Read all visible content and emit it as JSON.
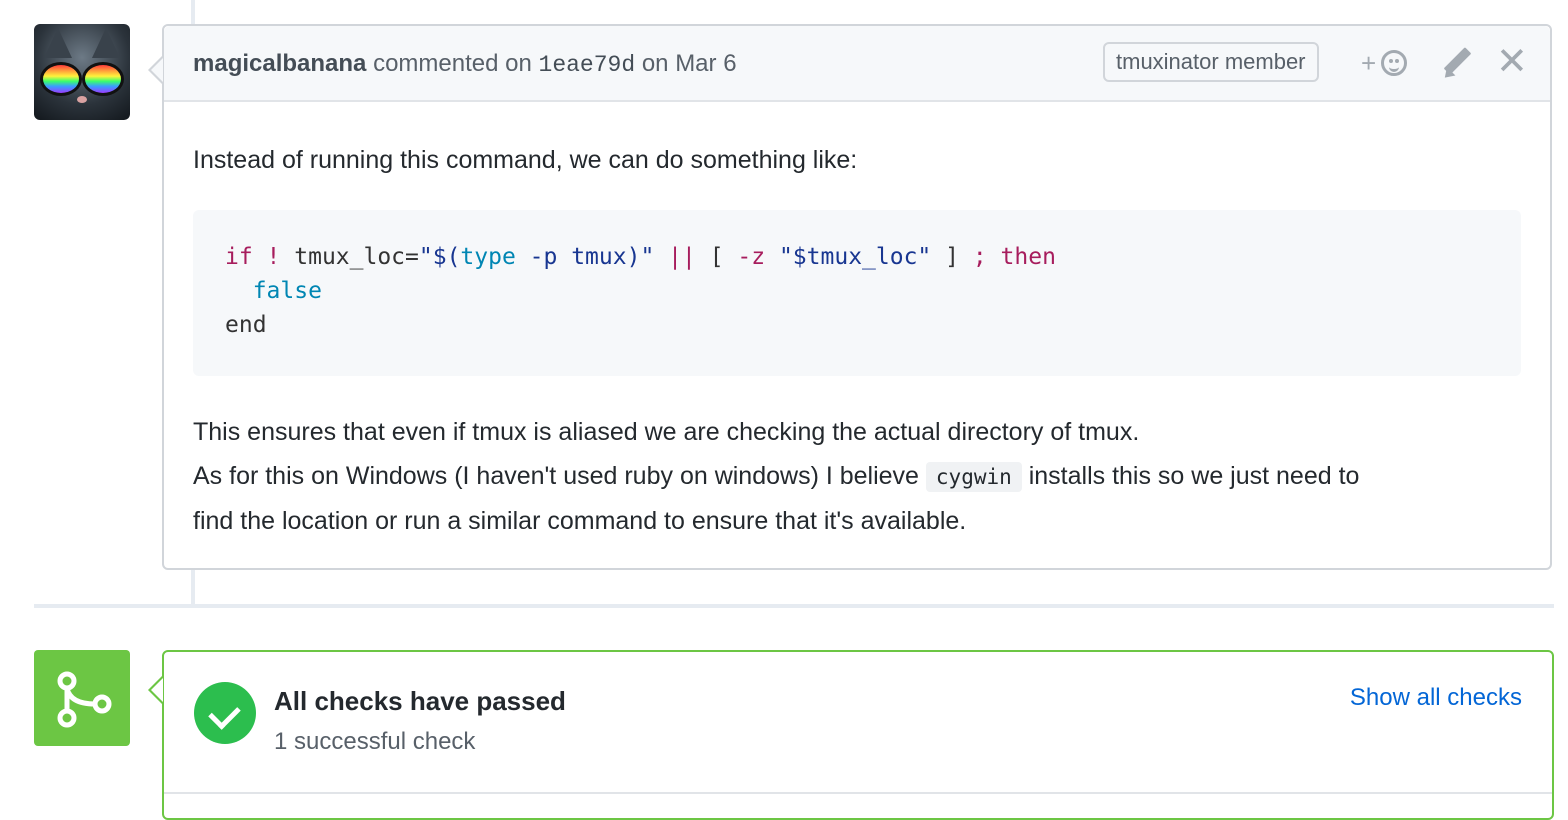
{
  "comment": {
    "author": "magicalbanana",
    "action": "commented on",
    "commit_sha": "1eae79d",
    "date_prefix": "on",
    "date": "Mar 6",
    "role_badge": "tmuxinator member",
    "react_plus": "+",
    "close_symbol": "✕",
    "body": {
      "intro": "Instead of running this command, we can do something like:",
      "code_tokens": {
        "l1_if": "if",
        "l1_bang": " ! ",
        "l1_var": "tmux_loc=",
        "l1_q1": "\"$(",
        "l1_type": "type",
        "l1_flag": " -p tmux",
        "l1_q2": ")\"",
        "l1_sp": " ",
        "l1_or": "||",
        "l1_br1": " [ ",
        "l1_z": "-z",
        "l1_str": " \"$tmux_loc\"",
        "l1_br2": " ] ",
        "l1_semi": ";",
        "l1_sp2": " ",
        "l1_then": "then",
        "l2_indent": "  ",
        "l2_false": "false",
        "l3_end": "end"
      },
      "para_line1": "This ensures that even if tmux is aliased we are checking the actual directory of tmux.",
      "para_line2_before": "As for this on Windows (I haven't used ruby on windows) I believe ",
      "inline_code": "cygwin",
      "para_line2_after": " installs this so we just need to",
      "para_line3": "find the location or run a similar command to ensure that it's available."
    }
  },
  "checks": {
    "title": "All checks have passed",
    "subtitle": "1 successful check",
    "show_all": "Show all checks"
  },
  "colors": {
    "success_green": "#2cbe4e",
    "merge_green": "#6cc644",
    "link_blue": "#0366d6"
  },
  "icons": [
    "avatar-image",
    "add-reaction-icon",
    "pencil-icon",
    "close-icon",
    "git-merge-icon",
    "check-icon"
  ]
}
